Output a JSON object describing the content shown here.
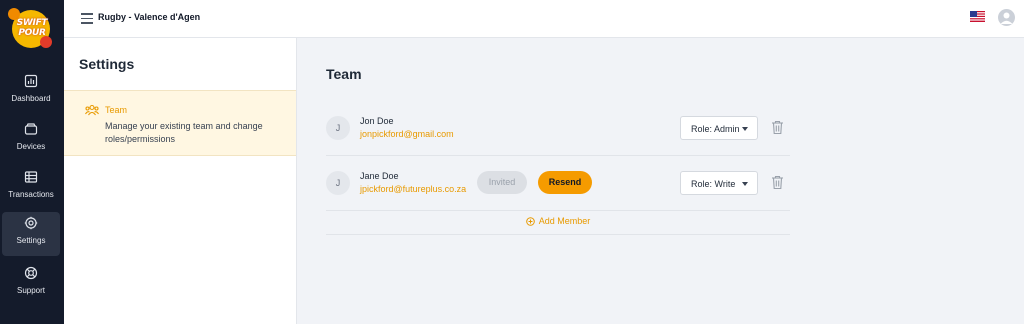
{
  "app": {
    "logo_line1": "SWIFT",
    "logo_line2": "POUR"
  },
  "sidebar": {
    "items": [
      {
        "label": "Dashboard",
        "icon": "chart-icon",
        "active": false
      },
      {
        "label": "Devices",
        "icon": "devices-icon",
        "active": false
      },
      {
        "label": "Transactions",
        "icon": "transactions-icon",
        "active": false
      },
      {
        "label": "Settings",
        "icon": "gear-icon",
        "active": true
      },
      {
        "label": "Support",
        "icon": "lifebuoy-icon",
        "active": false
      }
    ]
  },
  "header": {
    "title": "Rugby - Valence d'Agen",
    "flag": "us-flag-icon",
    "avatar": "user-avatar-icon"
  },
  "settings": {
    "title": "Settings",
    "items": [
      {
        "name": "Team",
        "description": "Manage your existing team and change roles/permissions",
        "icon": "team-icon",
        "active": true
      }
    ]
  },
  "team": {
    "title": "Team",
    "members": [
      {
        "initial": "J",
        "name": "Jon Doe",
        "email": "jonpickford@gmail.com",
        "status": "",
        "resend_label": "",
        "role": "Role: Admin"
      },
      {
        "initial": "J",
        "name": "Jane Doe",
        "email": "jpickford@futureplus.co.za",
        "status": "Invited",
        "resend_label": "Resend",
        "role": "Role: Write"
      }
    ],
    "add_member_label": "Add Member"
  },
  "colors": {
    "accent": "#f59b00",
    "sidebar_bg": "#141b2b",
    "active_item_bg": "#fff7e2"
  }
}
